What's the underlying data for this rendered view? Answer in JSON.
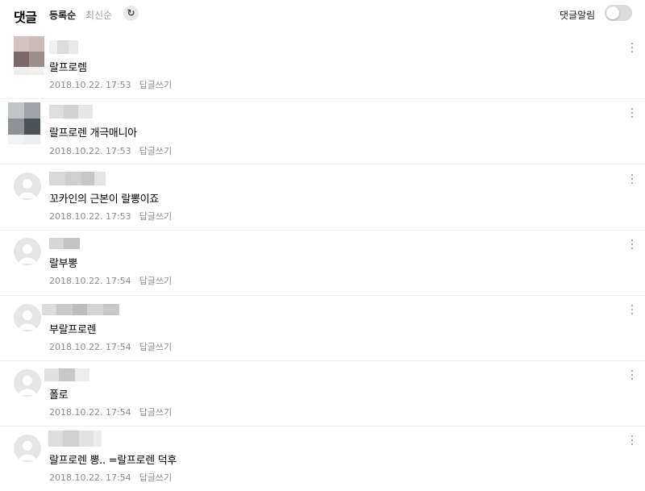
{
  "header": {
    "title": "댓글",
    "sort_active": "등록순",
    "sort_inactive": "최신순",
    "refresh_icon": "↻",
    "notify_label": "댓글알림",
    "notify_on": false
  },
  "comments": [
    {
      "text": "랄프로렘",
      "date": "2018.10.22. 17:53",
      "reply": "답글쓰기"
    },
    {
      "text": "랄프로렌 개극매니아",
      "date": "2018.10.22. 17:53",
      "reply": "답글쓰기"
    },
    {
      "text": "꼬카인의 근본이 랄뽕이죠",
      "date": "2018.10.22. 17:53",
      "reply": "답글쓰기"
    },
    {
      "text": "랄부뽕",
      "date": "2018.10.22. 17:54",
      "reply": "답글쓰기"
    },
    {
      "text": "부랄프로렌",
      "date": "2018.10.22. 17:54",
      "reply": "답글쓰기"
    },
    {
      "text": "폴로",
      "date": "2018.10.22. 17:54",
      "reply": "답글쓰기"
    },
    {
      "text": "랄프로렌 뽕.. =랄프로렌 덕후",
      "date": "2018.10.22. 17:54",
      "reply": "답글쓰기"
    }
  ]
}
